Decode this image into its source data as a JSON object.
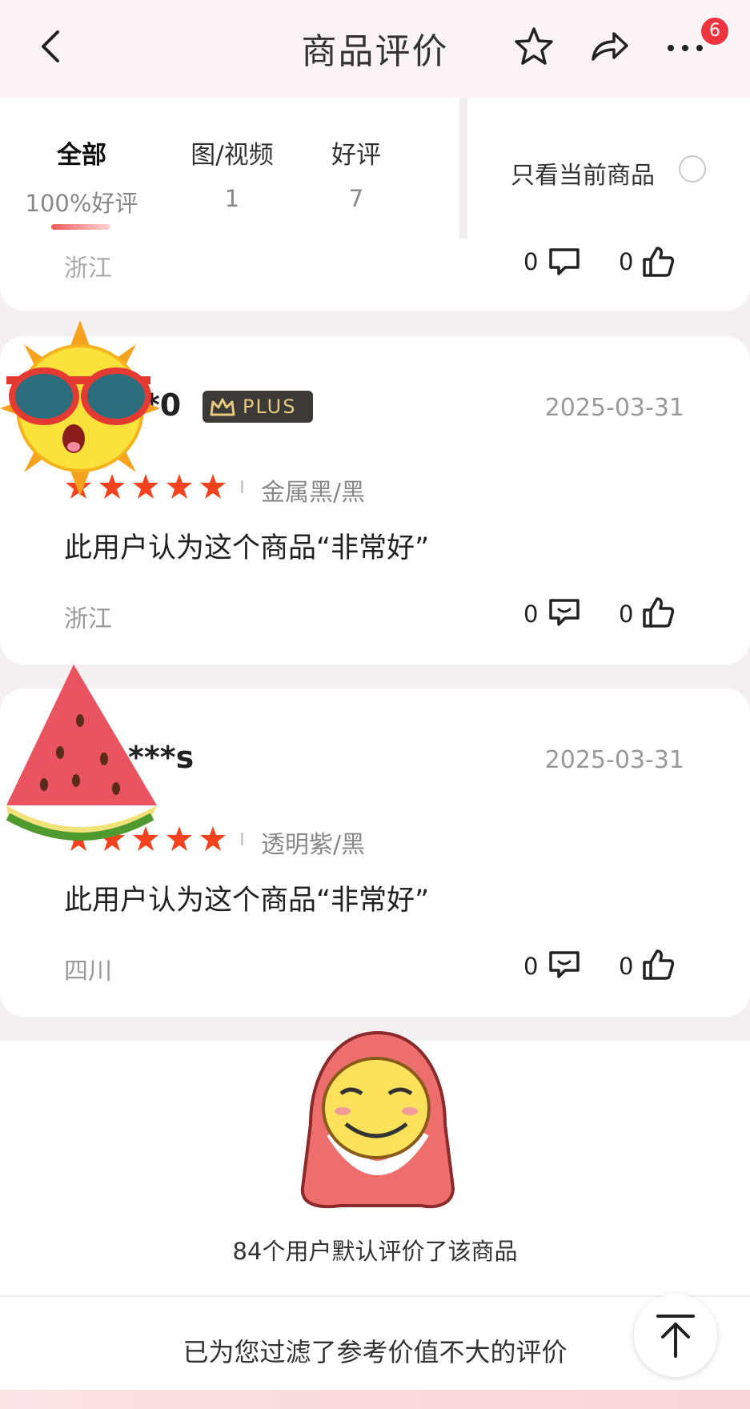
{
  "header": {
    "title": "商品评价",
    "badge_count": "6"
  },
  "filter": {
    "tabs": [
      {
        "label": "全部",
        "sub": "100%好评"
      },
      {
        "label": "图/视频",
        "sub": "1"
      },
      {
        "label": "好评",
        "sub": "7"
      }
    ],
    "only_current_label": "只看当前商品"
  },
  "prev_review": {
    "location": "浙江",
    "comments": "0",
    "likes": "0"
  },
  "reviews": [
    {
      "username": "**0",
      "membership": "PLUS",
      "date": "2025-03-31",
      "rating": 5,
      "sku": "金属黑/黑",
      "content": "此用户认为这个商品“非常好”",
      "location": "浙江",
      "comments": "0",
      "likes": "0"
    },
    {
      "username": "***s",
      "date": "2025-03-31",
      "rating": 5,
      "sku": "透明紫/黑",
      "content": "此用户认为这个商品“非常好”",
      "location": "四川",
      "comments": "0",
      "likes": "0"
    }
  ],
  "footer": {
    "default_reviews_note": "84个用户默认评价了该商品",
    "filtered_note": "已为您过滤了参考价值不大的评价"
  },
  "colors": {
    "star": "#f5421e",
    "badge": "#f0343f",
    "plus_bg": "#3c3a37",
    "plus_text": "#e8c980"
  }
}
